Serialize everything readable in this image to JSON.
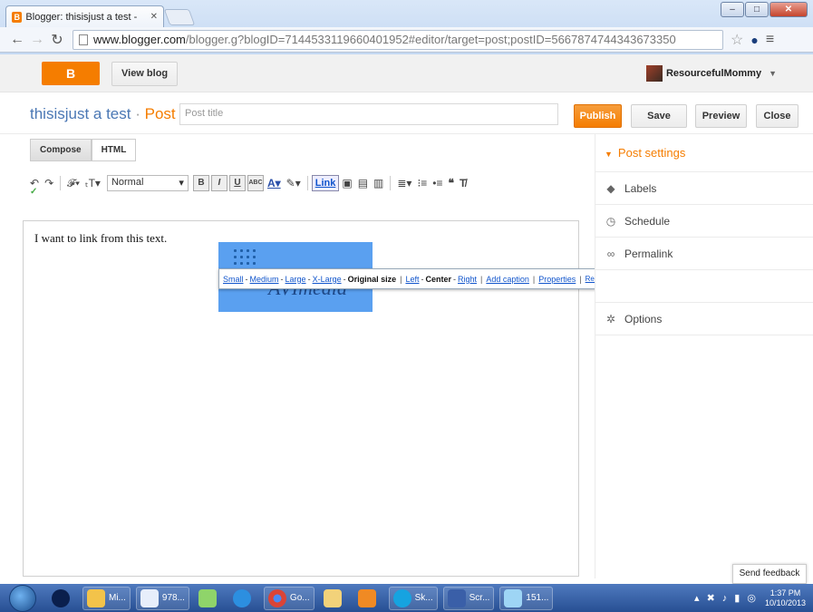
{
  "browser": {
    "tab_title": "Blogger: thisisjust a test - ",
    "url_host": "www.blogger.com",
    "url_path": "/blogger.g?blogID=7144533119660401952#editor/target=post;postID=5667874744343673350"
  },
  "header": {
    "view_blog": "View blog",
    "username": "ResourcefulMommy"
  },
  "post": {
    "blog_name": "thisisjust a test",
    "separator": "·",
    "post_word": "Post",
    "title_placeholder": "Post title",
    "publish": "Publish",
    "save": "Save",
    "preview": "Preview",
    "close": "Close"
  },
  "editor": {
    "tab_compose": "Compose",
    "tab_html": "HTML",
    "format_select": "Normal",
    "link_label": "Link",
    "body_text": "I want to link from this text.",
    "image_logo_text": "AVImedia",
    "image_popup": {
      "small": "Small",
      "medium": "Medium",
      "large": "Large",
      "xlarge": "X-Large",
      "original": "Original size",
      "left": "Left",
      "center": "Center",
      "right": "Right",
      "add_caption": "Add caption",
      "properties": "Properties",
      "remove": "Remove"
    }
  },
  "sidebar": {
    "title": "Post settings",
    "items": [
      {
        "label": "Labels",
        "icon": "label-icon"
      },
      {
        "label": "Schedule",
        "icon": "clock-icon"
      },
      {
        "label": "Permalink",
        "icon": "link-icon"
      },
      {
        "label": "",
        "icon": ""
      },
      {
        "label": "Options",
        "icon": "gear-icon"
      }
    ]
  },
  "feedback": "Send feedback",
  "taskbar": {
    "items": [
      "Mi...",
      "978...",
      "Go...",
      "Sk...",
      "Scr...",
      "151..."
    ],
    "time": "1:37 PM",
    "date": "10/10/2013"
  },
  "colors": {
    "accent": "#f57d00",
    "link": "#4a77b4"
  }
}
